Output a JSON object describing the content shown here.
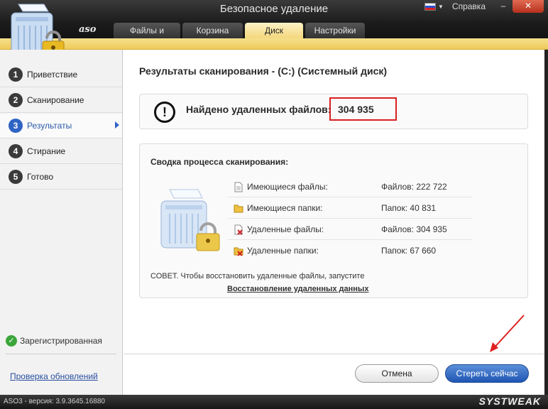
{
  "window": {
    "title": "Безопасное удаление",
    "help": "Справка",
    "minimize_glyph": "–",
    "close_glyph": "✕"
  },
  "header": {
    "app_logo_text": "aso",
    "tabs": [
      {
        "label": "Файлы и папки",
        "active": false
      },
      {
        "label": "Корзина",
        "active": false
      },
      {
        "label": "Диск",
        "active": true
      },
      {
        "label": "Настройки",
        "active": false
      }
    ]
  },
  "sidebar": {
    "steps": [
      {
        "number": "1",
        "label": "Приветствие"
      },
      {
        "number": "2",
        "label": "Сканирование"
      },
      {
        "number": "3",
        "label": "Результаты",
        "active": true
      },
      {
        "number": "4",
        "label": "Стирание"
      },
      {
        "number": "5",
        "label": "Готово"
      }
    ],
    "registered": "Зарегистрированная",
    "check_updates": "Проверка обновлений"
  },
  "main": {
    "title": "Результаты сканирования - (C:)  (Системный диск)",
    "found_label": "Найдено удаленных файлов:",
    "found_count": "304 935",
    "summary": {
      "title": "Сводка процесса сканирования:",
      "rows": [
        {
          "icon": "document-icon",
          "label": "Имеющиеся файлы:",
          "value": "Файлов: 222 722"
        },
        {
          "icon": "folder-icon",
          "label": "Имеющиеся папки:",
          "value": "Папок: 40 831"
        },
        {
          "icon": "deleted-file-icon",
          "label": "Удаленные файлы:",
          "value": "Файлов: 304 935"
        },
        {
          "icon": "deleted-folder-icon",
          "label": "Удаленные папки:",
          "value": "Папок: 67 660"
        }
      ],
      "tip": "СОВЕТ. Чтобы восстановить удаленные файлы, запустите",
      "tip_link": "Восстановление удаленных данных"
    },
    "buttons": {
      "cancel": "Отмена",
      "erase": "Стереть сейчас"
    }
  },
  "status_bar": {
    "version": "ASO3 - версия: 3.9.3645.16880",
    "brand": "SYSTWEAK"
  },
  "colors": {
    "accent_yellow": "#f3d77c",
    "accent_blue": "#2e64c4",
    "highlight_red": "#d82020"
  }
}
